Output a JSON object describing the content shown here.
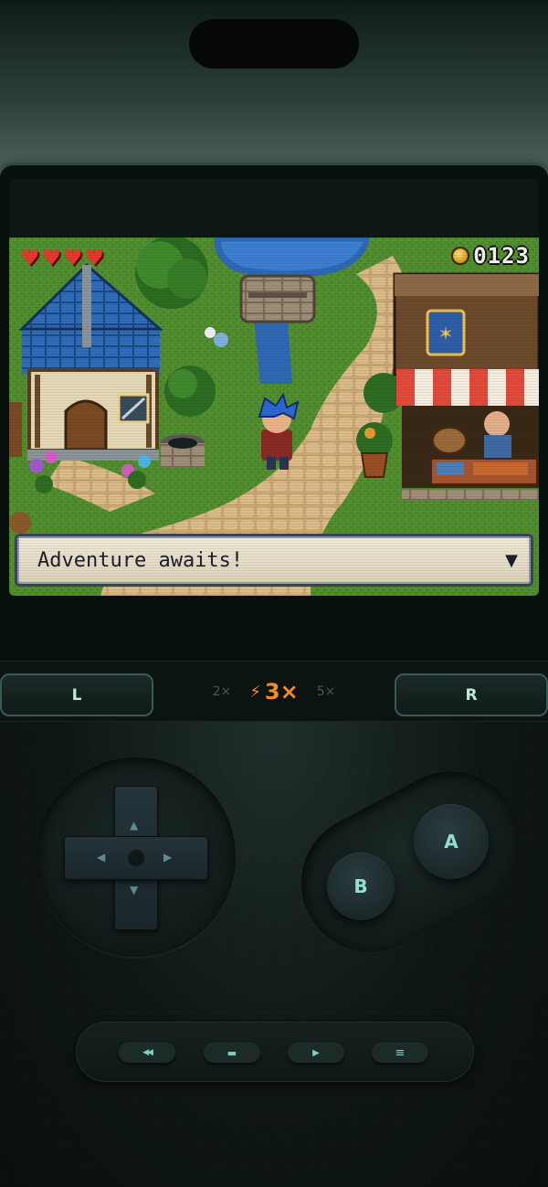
{
  "hud": {
    "hearts": [
      "♥",
      "♥",
      "♥",
      "♥"
    ],
    "coin_count": "0123"
  },
  "dialog": {
    "text": "Adventure awaits!",
    "continue_icon": "▼"
  },
  "shoulders": {
    "left_label": "L",
    "right_label": "R"
  },
  "speed": {
    "options": [
      "2×",
      "3×",
      "5×"
    ],
    "active": "3×",
    "active_icon": "⚡"
  },
  "face_buttons": {
    "a_label": "A",
    "b_label": "B"
  },
  "dpad": {
    "up": "▲",
    "down": "▼",
    "left": "◀",
    "right": "▶"
  },
  "utility": {
    "rewind_icon": "◀◀",
    "stop_icon": "▬",
    "play_icon": "▶",
    "menu_icon": "≡"
  },
  "colors": {
    "accent_speed": "#f08a2a",
    "button_label": "#8fe0cc",
    "hearts": "#e43a2c"
  }
}
